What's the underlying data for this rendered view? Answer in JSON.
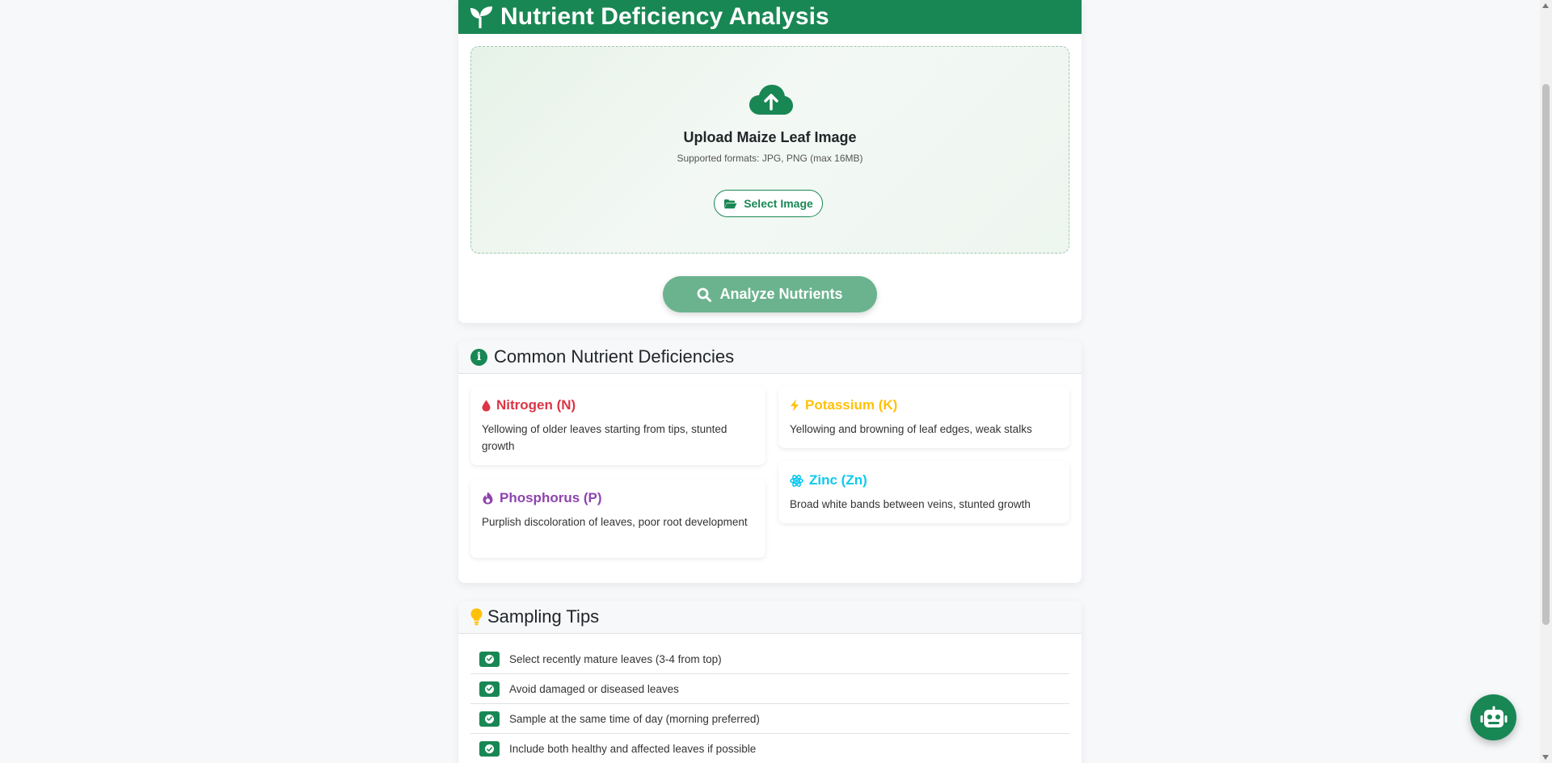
{
  "analysis": {
    "title": "Nutrient Deficiency Analysis",
    "upload_title": "Upload Maize Leaf Image",
    "upload_formats": "Supported formats: JPG, PNG (max 16MB)",
    "select_label": "Select Image",
    "analyze_label": "Analyze Nutrients"
  },
  "deficiencies": {
    "title": "Common Nutrient Deficiencies",
    "items": [
      {
        "name": "Nitrogen (N)",
        "description": "Yellowing of older leaves starting from tips, stunted growth",
        "color": "#dc3545",
        "icon": "droplet-icon"
      },
      {
        "name": "Potassium (K)",
        "description": "Yellowing and browning of leaf edges, weak stalks",
        "color": "#ffc107",
        "icon": "bolt-icon"
      },
      {
        "name": "Phosphorus (P)",
        "description": "Purplish discoloration of leaves, poor root development",
        "color": "#8e44ad",
        "icon": "flame-icon"
      },
      {
        "name": "Zinc (Zn)",
        "description": "Broad white bands between veins, stunted growth",
        "color": "#0dcaf0",
        "icon": "atom-icon"
      }
    ]
  },
  "tips": {
    "title": "Sampling Tips",
    "items": [
      "Select recently mature leaves (3-4 from top)",
      "Avoid damaged or diseased leaves",
      "Sample at the same time of day (morning preferred)",
      "Include both healthy and affected leaves if possible"
    ]
  },
  "colors": {
    "primary": "#198754",
    "analyze_disabled": "#6bb38e"
  }
}
